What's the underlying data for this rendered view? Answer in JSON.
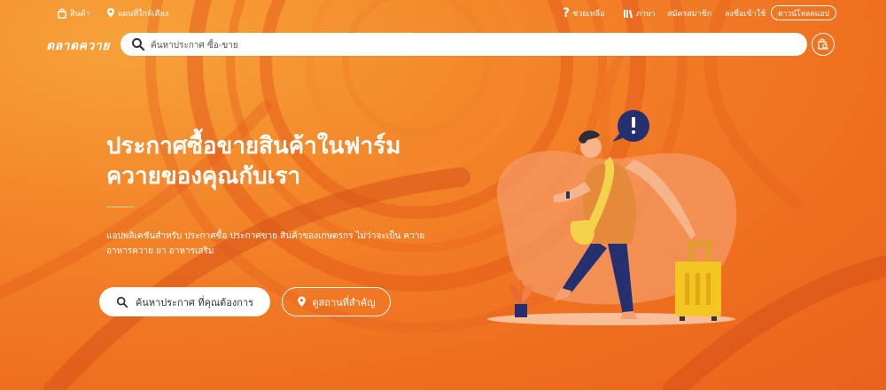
{
  "topbar": {
    "products_label": "สินค้า",
    "nearby_label": "แผนที่ใกล้เคียง",
    "help_label": "ช่วยเหลือ",
    "language_label": "ภาษา",
    "register_label": "สมัครสมาชิก",
    "login_label": "ลงชื่อเข้าใช้",
    "download_label": "ดาวน์โหลดแอป"
  },
  "header": {
    "logo_text": "ตลาดควาย",
    "search_placeholder": "ค้นหาประกาศ ซื้อ-ขาย"
  },
  "hero": {
    "headline_line1": "ประกาศซื้อขายสินค้าในฟาร์ม",
    "headline_line2": "ควายของคุณกับเรา",
    "description_line1": "แอปพลิเคชันสำหรับ ประกาศซื้อ ประกาศขาย สินค้าของเกษตรกร ไม่ว่าจะเป็น ควาย",
    "description_line2": "อาหารควาย ยา อาหารเสริม",
    "search_button_label": "ค้นหาประกาศ ที่คุณต้องการ",
    "places_button_label": "ดูสถานที่สำคัญ"
  },
  "colors": {
    "background": "#ef6f1f",
    "accent": "#ffffff",
    "text_dark": "#333333"
  },
  "icons": [
    "shopping-bag-icon",
    "location-pin-icon",
    "question-icon",
    "library-icon",
    "search-icon",
    "cart-search-icon",
    "traveler-illustration"
  ]
}
